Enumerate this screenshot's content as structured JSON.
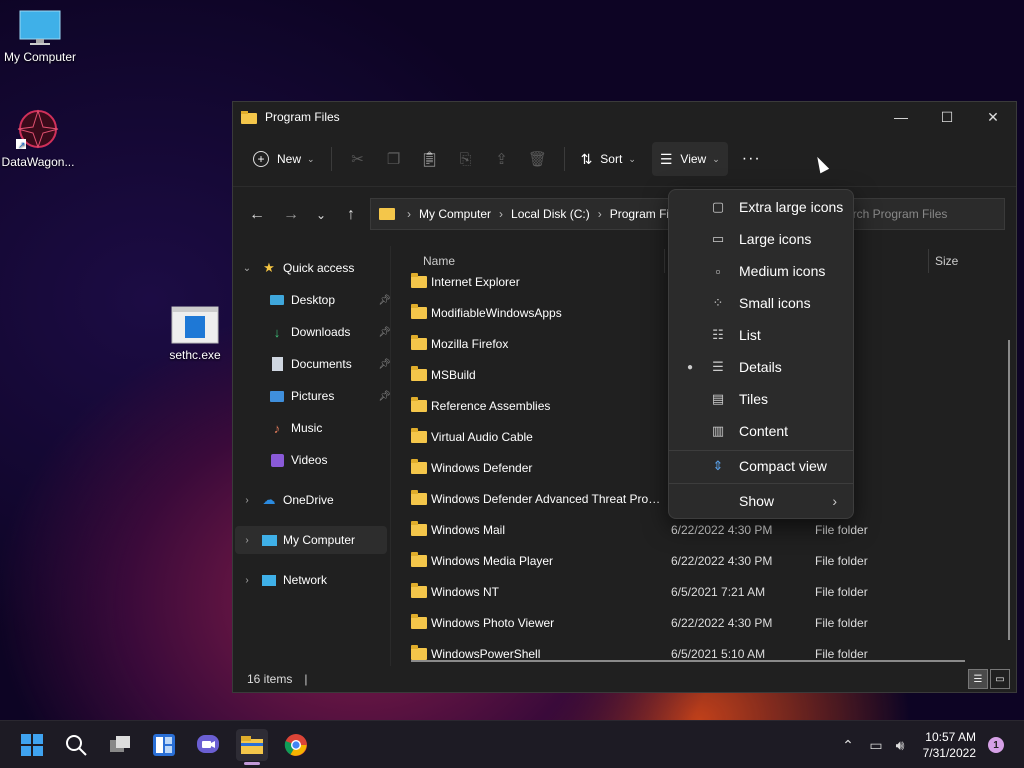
{
  "desktop": {
    "icons": [
      {
        "label": "My Computer"
      },
      {
        "label": "DataWagon..."
      },
      {
        "label": "sethc.exe"
      }
    ]
  },
  "window": {
    "title": "Program Files",
    "controls": {
      "minimize": "—",
      "maximize": "☐",
      "close": "✕"
    }
  },
  "toolbar": {
    "new_label": "New",
    "sort_label": "Sort",
    "view_label": "View",
    "more_label": "···"
  },
  "address": {
    "crumbs": [
      "My Computer",
      "Local Disk (C:)",
      "Program Fi"
    ],
    "search_placeholder": "arch Program Files"
  },
  "sidebar": {
    "items": [
      {
        "label": "Quick access"
      },
      {
        "label": "Desktop"
      },
      {
        "label": "Downloads"
      },
      {
        "label": "Documents"
      },
      {
        "label": "Pictures"
      },
      {
        "label": "Music"
      },
      {
        "label": "Videos"
      },
      {
        "label": "OneDrive"
      },
      {
        "label": "My Computer"
      },
      {
        "label": "Network"
      }
    ]
  },
  "columns": {
    "name": "Name",
    "size": "Size"
  },
  "files": [
    {
      "name": "Internet Explorer",
      "date": "",
      "type": ""
    },
    {
      "name": "ModifiableWindowsApps",
      "date": "",
      "type": ""
    },
    {
      "name": "Mozilla Firefox",
      "date": "",
      "type": ""
    },
    {
      "name": "MSBuild",
      "date": "",
      "type": ""
    },
    {
      "name": "Reference Assemblies",
      "date": "",
      "type": ""
    },
    {
      "name": "Virtual Audio Cable",
      "date": "",
      "type": ""
    },
    {
      "name": "Windows Defender",
      "date": "",
      "type": ""
    },
    {
      "name": "Windows Defender Advanced Threat Prot...",
      "date": "",
      "type": ""
    },
    {
      "name": "Windows Mail",
      "date": "6/22/2022 4:30 PM",
      "type": "File folder"
    },
    {
      "name": "Windows Media Player",
      "date": "6/22/2022 4:30 PM",
      "type": "File folder"
    },
    {
      "name": "Windows NT",
      "date": "6/5/2021 7:21 AM",
      "type": "File folder"
    },
    {
      "name": "Windows Photo Viewer",
      "date": "6/22/2022 4:30 PM",
      "type": "File folder"
    },
    {
      "name": "WindowsPowerShell",
      "date": "6/5/2021 5:10 AM",
      "type": "File folder"
    }
  ],
  "status": {
    "count": "16 items"
  },
  "view_menu": {
    "items": [
      {
        "label": "Extra large icons"
      },
      {
        "label": "Large icons"
      },
      {
        "label": "Medium icons"
      },
      {
        "label": "Small icons"
      },
      {
        "label": "List"
      },
      {
        "label": "Details",
        "selected": true
      },
      {
        "label": "Tiles"
      },
      {
        "label": "Content"
      },
      {
        "label": "Compact view"
      },
      {
        "label": "Show"
      }
    ]
  },
  "taskbar": {
    "time": "10:57 AM",
    "date": "7/31/2022",
    "notifications": "1"
  }
}
